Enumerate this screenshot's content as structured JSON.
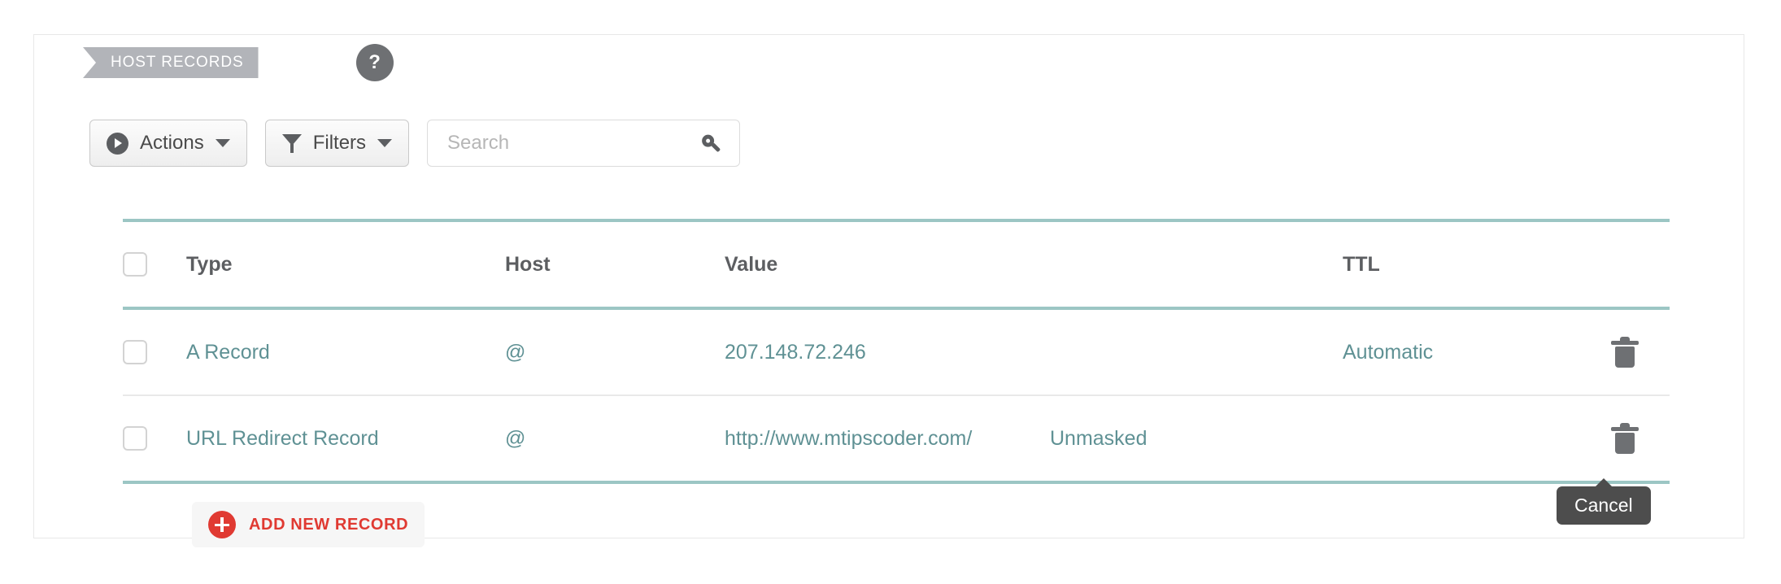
{
  "panel": {
    "ribbon_label": "HOST RECORDS",
    "help_label": "?"
  },
  "toolbar": {
    "actions_label": "Actions",
    "filters_label": "Filters",
    "search_placeholder": "Search",
    "search_value": ""
  },
  "table": {
    "columns": {
      "type": "Type",
      "host": "Host",
      "value": "Value",
      "ttl": "TTL"
    },
    "rows": [
      {
        "type": "A Record",
        "host": "@",
        "value": "207.148.72.246",
        "extra": "",
        "ttl": "Automatic"
      },
      {
        "type": "URL Redirect Record",
        "host": "@",
        "value": "http://www.mtipscoder.com/",
        "extra": "Unmasked",
        "ttl": ""
      }
    ]
  },
  "footer": {
    "add_label": "ADD NEW RECORD"
  },
  "tooltip": {
    "label": "Cancel"
  },
  "colors": {
    "ribbon": "#b2b4b9",
    "teal_rule": "#9cc6c4",
    "link_text": "#5f9194",
    "accent_red": "#e03a32",
    "tooltip_bg": "#4d4d4d"
  }
}
